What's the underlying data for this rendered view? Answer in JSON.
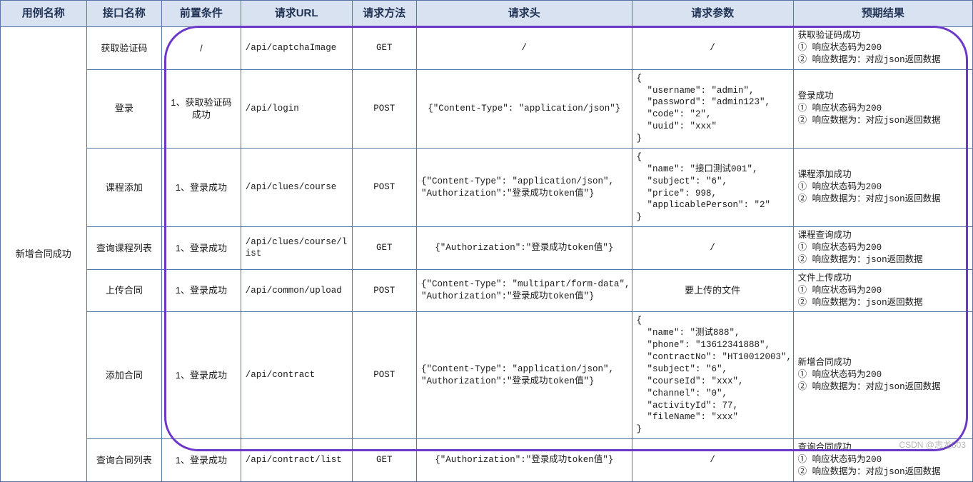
{
  "headers": {
    "case_name": "用例名称",
    "interface_name": "接口名称",
    "precondition": "前置条件",
    "url": "请求URL",
    "method": "请求方法",
    "req_header": "请求头",
    "req_param": "请求参数",
    "expected": "预期结果"
  },
  "case_name": "新增合同成功",
  "rows": [
    {
      "interface_name": "获取验证码",
      "precondition": "/",
      "url": "/api/captchaImage",
      "method": "GET",
      "req_header": "/",
      "req_param": "/",
      "expected": "获取验证码成功\n① 响应状态码为200\n② 响应数据为：对应json返回数据"
    },
    {
      "interface_name": "登录",
      "precondition": "1、获取验证码成功",
      "url": "/api/login",
      "method": "POST",
      "req_header": "{\"Content-Type\": \"application/json\"}",
      "req_param": "{\n  \"username\": \"admin\",\n  \"password\": \"admin123\",\n  \"code\": \"2\",\n  \"uuid\": \"xxx\"\n}",
      "expected": "登录成功\n① 响应状态码为200\n② 响应数据为：对应json返回数据"
    },
    {
      "interface_name": "课程添加",
      "precondition": "1、登录成功",
      "url": "/api/clues/course",
      "method": "POST",
      "req_header": "{\"Content-Type\": \"application/json\",\n\"Authorization\":\"登录成功token值\"}",
      "req_param": "{\n  \"name\": \"接口测试001\",\n  \"subject\": \"6\",\n  \"price\": 998,\n  \"applicablePerson\": \"2\"\n}",
      "expected": "课程添加成功\n① 响应状态码为200\n② 响应数据为：对应json返回数据"
    },
    {
      "interface_name": "查询课程列表",
      "precondition": "1、登录成功",
      "url": "/api/clues/course/list",
      "method": "GET",
      "req_header": "{\"Authorization\":\"登录成功token值\"}",
      "req_param": "/",
      "expected": "课程查询成功\n① 响应状态码为200\n② 响应数据为：json返回数据"
    },
    {
      "interface_name": "上传合同",
      "precondition": "1、登录成功",
      "url": "/api/common/upload",
      "method": "POST",
      "req_header": "{\"Content-Type\": \"multipart/form-data\",\n\"Authorization\":\"登录成功token值\"}",
      "req_param": "要上传的文件",
      "expected": "文件上传成功\n① 响应状态码为200\n② 响应数据为：json返回数据"
    },
    {
      "interface_name": "添加合同",
      "precondition": "1、登录成功",
      "url": "/api/contract",
      "method": "POST",
      "req_header": "{\"Content-Type\": \"application/json\",\n\"Authorization\":\"登录成功token值\"}",
      "req_param": "{\n  \"name\": \"测试888\",\n  \"phone\": \"13612341888\",\n  \"contractNo\": \"HT10012003\",\n  \"subject\": \"6\",\n  \"courseId\": \"xxx\",\n  \"channel\": \"0\",\n  \"activityId\": 77,\n  \"fileName\": \"xxx\"\n}",
      "expected": "新增合同成功\n① 响应状态码为200\n② 响应数据为：对应json返回数据"
    },
    {
      "interface_name": "查询合同列表",
      "precondition": "1、登录成功",
      "url": "/api/contract/list",
      "method": "GET",
      "req_header": "{\"Authorization\":\"登录成功token值\"}",
      "req_param": "/",
      "expected": "查询合同成功\n① 响应状态码为200\n② 响应数据为：对应json返回数据"
    }
  ],
  "watermark": "CSDN @志龙303"
}
